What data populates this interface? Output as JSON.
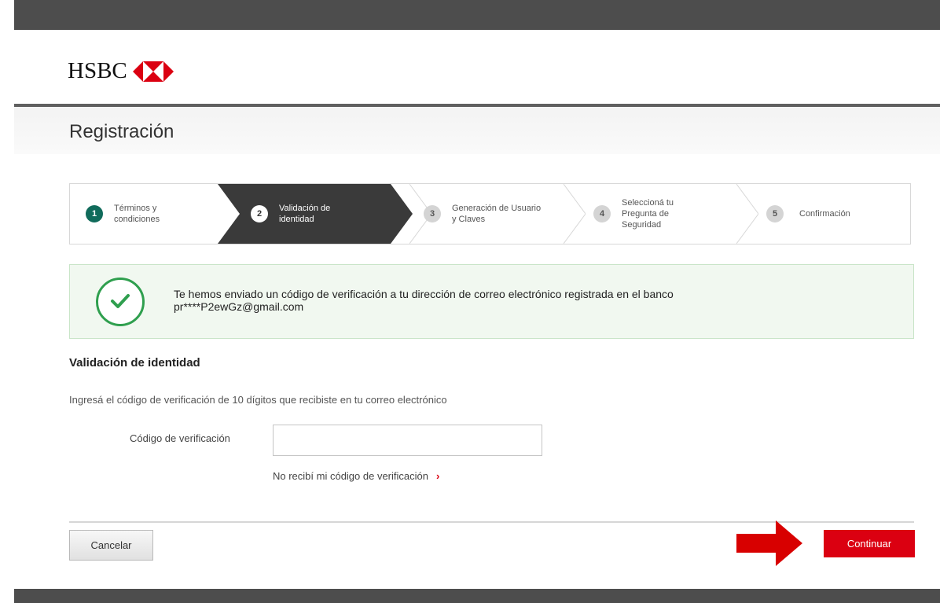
{
  "header": {
    "logo_text": "HSBC",
    "brand_color": "#db0011"
  },
  "page": {
    "title": "Registración"
  },
  "stepper": {
    "steps": [
      {
        "number": "1",
        "label": "Términos y condiciones",
        "state": "done"
      },
      {
        "number": "2",
        "label": "Validación de identidad",
        "state": "active"
      },
      {
        "number": "3",
        "label": "Generación de Usuario y Claves",
        "state": "pending"
      },
      {
        "number": "4",
        "label": "Seleccioná tu Pregunta de Seguridad",
        "state": "pending"
      },
      {
        "number": "5",
        "label": "Confirmación",
        "state": "pending"
      }
    ],
    "active_color": "#3a3a3a",
    "done_color": "#106b5b"
  },
  "alert": {
    "icon": "check-circle-icon",
    "message": "Te hemos enviado un código de verificación a tu dirección de correo electrónico registrada en el banco",
    "email": "pr****P2ewGz@gmail.com",
    "color": "#2f9f4e"
  },
  "form": {
    "section_title": "Validación de identidad",
    "instructions": "Ingresá el código de verificación de 10 dígitos que recibiste en tu correo electrónico",
    "code_label": "Código de verificación",
    "code_value": "",
    "resend_link": "No recibí mi código de verificación",
    "resend_icon": "chevron-right-icon"
  },
  "actions": {
    "cancel_label": "Cancelar",
    "continue_label": "Continuar",
    "continue_color": "#db0011"
  }
}
